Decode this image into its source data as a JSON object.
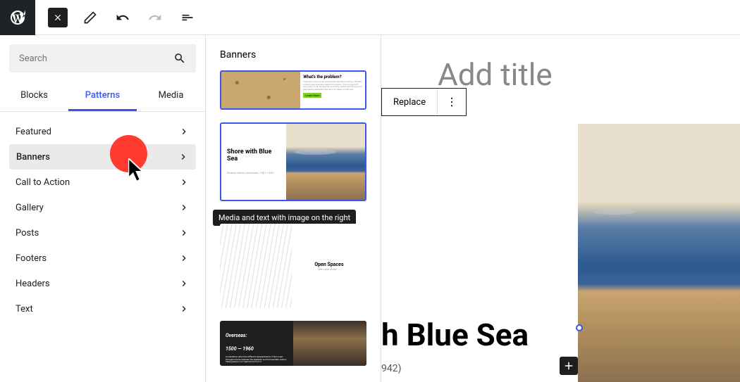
{
  "topbar": {
    "search_placeholder": "Search"
  },
  "tabs": {
    "blocks": "Blocks",
    "patterns": "Patterns",
    "media": "Media"
  },
  "categories": [
    {
      "label": "Featured"
    },
    {
      "label": "Banners"
    },
    {
      "label": "Call to Action"
    },
    {
      "label": "Gallery"
    },
    {
      "label": "Posts"
    },
    {
      "label": "Footers"
    },
    {
      "label": "Headers"
    },
    {
      "label": "Text"
    }
  ],
  "patterns_panel": {
    "title": "Banners",
    "tooltip": "Media and text with image on the right",
    "p1": {
      "title": "What's the problem?",
      "btn": "Learn More"
    },
    "p2": {
      "title": "Shore with Blue Sea"
    },
    "p3": {
      "title": "Open Spaces"
    },
    "p4": {
      "title": "Overseas:",
      "subtitle": "1500 — 1960"
    }
  },
  "toolbar": {
    "replace": "Replace"
  },
  "canvas": {
    "title_placeholder": "Add title",
    "heading_fragment": "h Blue Sea",
    "sub_fragment": "942)"
  }
}
